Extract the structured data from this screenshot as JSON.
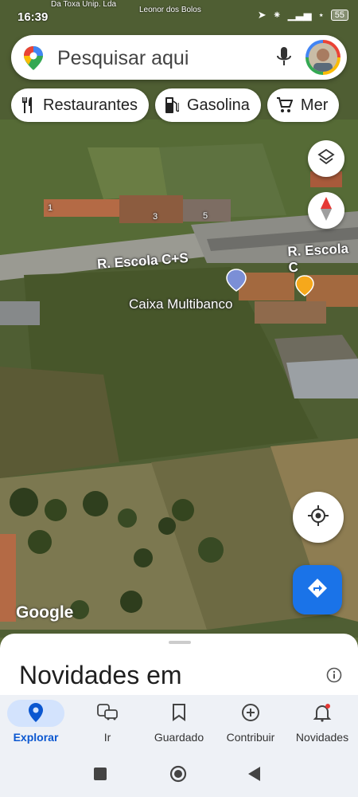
{
  "status_bar": {
    "time": "16:39",
    "battery": "55",
    "map_labels": [
      "Da Toxa Unip. Lda",
      "Leonor dos Bolos"
    ]
  },
  "search": {
    "placeholder": "Pesquisar aqui"
  },
  "chips": [
    {
      "label": "Restaurantes",
      "icon": "restaurant-icon"
    },
    {
      "label": "Gasolina",
      "icon": "gas-station-icon"
    },
    {
      "label": "Mer",
      "icon": "shopping-cart-icon"
    }
  ],
  "map": {
    "street_labels": [
      "R. Escola C+S",
      "R. Escola C"
    ],
    "poi_labels": [
      "Caixa Multibanco"
    ],
    "house_numbers": [
      "1",
      "3",
      "5"
    ],
    "google_logo": "Google",
    "colors": {
      "accent": "#1a73e8",
      "poi_blue": "#7b8fd6",
      "poi_orange": "#f6a81b"
    }
  },
  "sheet": {
    "title": "Novidades em"
  },
  "bottom_nav": [
    {
      "label": "Explorar",
      "icon": "explore-pin-icon",
      "active": true
    },
    {
      "label": "Ir",
      "icon": "commute-icon",
      "active": false
    },
    {
      "label": "Guardado",
      "icon": "bookmark-icon",
      "active": false
    },
    {
      "label": "Contribuir",
      "icon": "add-circle-icon",
      "active": false
    },
    {
      "label": "Novidades",
      "icon": "bell-icon",
      "active": false
    }
  ]
}
